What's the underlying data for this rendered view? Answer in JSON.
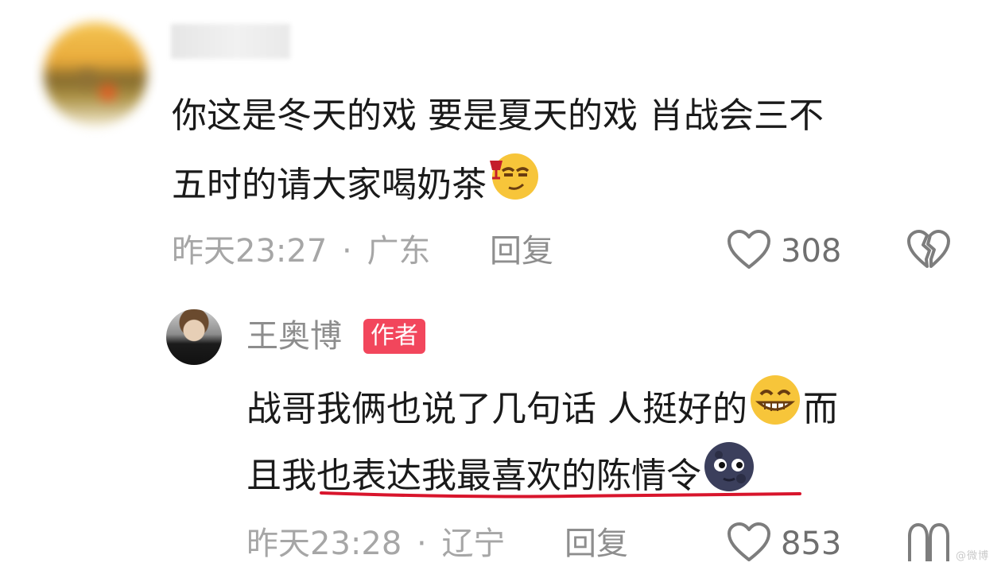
{
  "comment": {
    "text_line1": "你这是冬天的戏 要是夏天的戏 肖战会三不",
    "text_line2": "五时的请大家喝奶茶",
    "emoji": "smirk-toast-emoji",
    "time": "昨天23:27",
    "separator": "·",
    "location": "广东",
    "reply_label": "回复",
    "like_count": "308"
  },
  "reply": {
    "author": "王奥博",
    "badge": "作者",
    "text_line1_part1": "战哥我俩也说了几句话 人挺好的",
    "text_line1_part2": "而",
    "text_line2": "且我也表达我最喜欢的陈情令",
    "emoji1": "grin-emoji",
    "emoji2": "new-moon-face-emoji",
    "time": "昨天23:28",
    "separator": "·",
    "location": "辽宁",
    "reply_label": "回复",
    "like_count": "853",
    "underline_color": "#d8152c"
  },
  "colors": {
    "badge": "#f2465c",
    "meta_text": "#a6a6a6",
    "body_text": "#1a1a1a"
  },
  "watermark": "@微博"
}
